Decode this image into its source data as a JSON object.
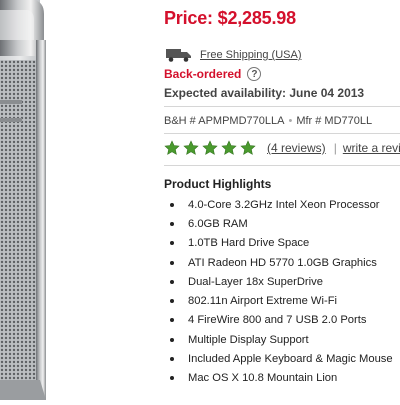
{
  "price": {
    "text": "Price: $2,285.98",
    "color": "#d4102c"
  },
  "shipping": {
    "icon": "truck-icon",
    "label": "Free Shipping (USA)"
  },
  "availability": {
    "status": "Back-ordered",
    "help_icon": "question-mark-icon",
    "help_glyph": "?",
    "expected": "Expected availability: June 04 2013"
  },
  "sku": {
    "bh_label": "B&H # APMPMD770LLA",
    "separator": "•",
    "mfr_label": "Mfr # MD770LL"
  },
  "rating": {
    "stars": 5,
    "star_color": "#4a9a2e",
    "reviews_label": "(4 reviews)",
    "separator": "|",
    "write_label": "write a review"
  },
  "highlights": {
    "title": "Product Highlights",
    "items": [
      "4.0-Core 3.2GHz Intel Xeon Processor",
      "6.0GB RAM",
      "1.0TB Hard Drive Space",
      "ATI Radeon HD 5770 1.0GB Graphics",
      "Dual-Layer 18x SuperDrive",
      "802.11n Airport Extreme Wi-Fi",
      "4 FireWire 800 and 7 USB 2.0 Ports",
      "Multiple Display Support",
      "Included Apple Keyboard & Magic Mouse",
      "Mac OS X 10.8 Mountain Lion"
    ]
  }
}
